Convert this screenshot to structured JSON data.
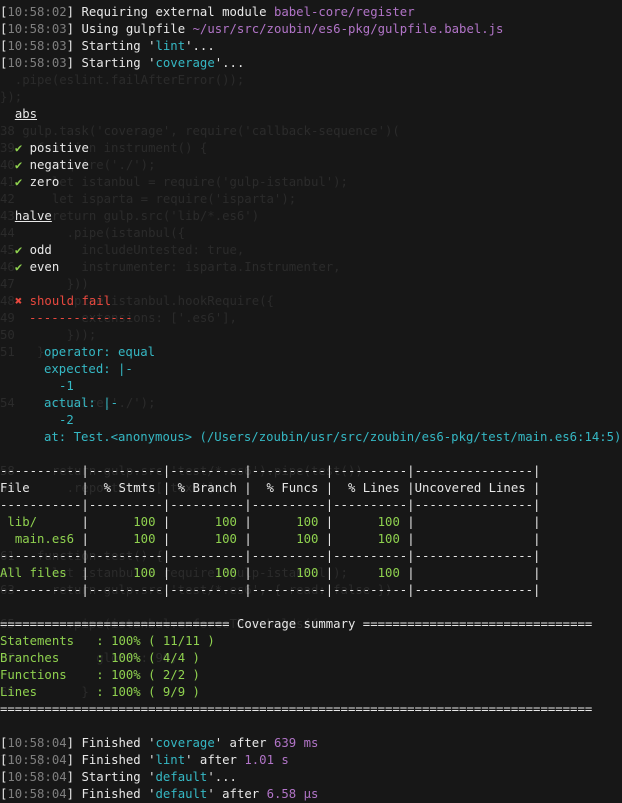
{
  "log_top": [
    {
      "time": "10:58:02",
      "pre": "Requiring external module ",
      "hl": "babel-core/register",
      "hl_color": "mag",
      "post": ""
    },
    {
      "time": "10:58:03",
      "pre": "Using gulpfile ",
      "hl": "~/usr/src/zoubin/es6-pkg/gulpfile.babel.js",
      "hl_color": "mag",
      "post": ""
    },
    {
      "time": "10:58:03",
      "pre": "Starting '",
      "hl": "lint",
      "hl_color": "cyan",
      "post": "'..."
    },
    {
      "time": "10:58:03",
      "pre": "Starting '",
      "hl": "coverage",
      "hl_color": "cyan",
      "post": "'..."
    }
  ],
  "tests": {
    "suite1": {
      "title": "abs",
      "passed": [
        "positive",
        "negative",
        "zero"
      ]
    },
    "suite2": {
      "title": "halve",
      "passed": [
        "odd",
        "even"
      ]
    },
    "failing": {
      "title": "should fail",
      "dashes": "--------------",
      "operator": "operator: equal",
      "expected_label": "expected: |-",
      "expected_value": "-1",
      "actual_label": "actual: |-",
      "actual_value": "-2",
      "at": "at: Test.<anonymous> (/Users/zoubin/usr/src/zoubin/es6-pkg/test/main.es6:14:5)"
    }
  },
  "coverage_table": {
    "separator": "-----------|----------|----------|----------|----------|----------------|",
    "header": "File       |  % Stmts | % Branch |  % Funcs |  % Lines |Uncovered Lines |",
    "rows": [
      {
        "name": "lib/",
        "stmts": "100",
        "branch": "100",
        "funcs": "100",
        "lines": "100"
      },
      {
        "name": "main.es6",
        "stmts": "100",
        "branch": "100",
        "funcs": "100",
        "lines": "100"
      }
    ],
    "all": {
      "name": "All files",
      "stmts": "100",
      "branch": "100",
      "funcs": "100",
      "lines": "100"
    }
  },
  "summary": {
    "title": "Coverage summary",
    "items": [
      {
        "label": "Statements",
        "value": ": 100% ( 11/11 )"
      },
      {
        "label": "Branches",
        "value": ": 100% ( 4/4 )"
      },
      {
        "label": "Functions",
        "value": ": 100% ( 2/2 )"
      },
      {
        "label": "Lines",
        "value": ": 100% ( 9/9 )"
      }
    ]
  },
  "log_bottom": [
    {
      "time": "10:58:04",
      "pre": "Finished '",
      "hl": "coverage",
      "mid": "' after ",
      "dur": "639 ms"
    },
    {
      "time": "10:58:04",
      "pre": "Finished '",
      "hl": "lint",
      "mid": "' after ",
      "dur": "1.01 s"
    },
    {
      "time": "10:58:04",
      "pre": "Starting '",
      "hl": "default",
      "mid": "'...",
      "dur": ""
    },
    {
      "time": "10:58:04",
      "pre": "Finished '",
      "hl": "default",
      "mid": "' after ",
      "dur": "6.58 μs"
    }
  ],
  "colors": {
    "background": "#171717",
    "green": "#8fd14f",
    "red": "#e8483e",
    "cyan": "#35b8c4",
    "magenta": "#b174c7"
  },
  "icons": {
    "pass": "check-mark-icon",
    "fail": "cross-mark-icon"
  },
  "glyphs": {
    "check": "✔",
    "cross": "✖"
  }
}
